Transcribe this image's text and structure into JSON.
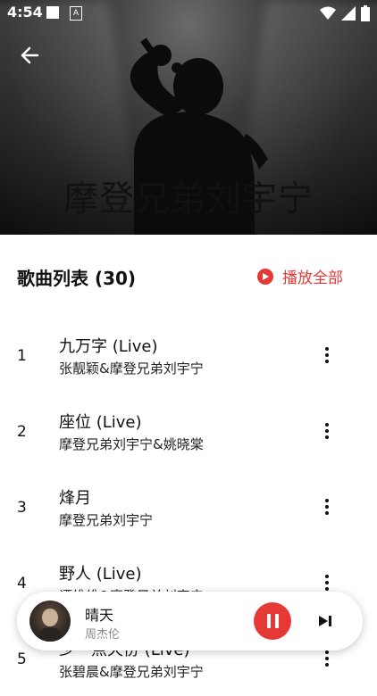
{
  "status_bar": {
    "time": "4:54",
    "notification_icon_letter": "A",
    "icons": [
      "square-icon",
      "a-notification-icon",
      "wifi-icon",
      "signal-icon",
      "battery-icon"
    ]
  },
  "header": {
    "back_icon": "arrow-left-icon",
    "artist_name": "摩登兄弟刘宇宁"
  },
  "list": {
    "title": "歌曲列表 (30)",
    "play_all_label": "播放全部",
    "play_all_icon": "play-circle-icon",
    "accent_color": "#e53935",
    "songs": [
      {
        "index": "1",
        "name": "九万字 (Live)",
        "artist": "张靓颖&摩登兄弟刘宇宁"
      },
      {
        "index": "2",
        "name": "座位 (Live)",
        "artist": "摩登兄弟刘宇宁&姚晓棠"
      },
      {
        "index": "3",
        "name": "烽月",
        "artist": "摩登兄弟刘宇宁"
      },
      {
        "index": "4",
        "name": "野人 (Live)",
        "artist": "谭维维&摩登兄弟刘宇宁"
      },
      {
        "index": "5",
        "name": "少一点天份 (Live)",
        "artist": "张碧晨&摩登兄弟刘宇宁"
      }
    ]
  },
  "mini_player": {
    "title": "晴天",
    "artist": "周杰伦",
    "pause_icon": "pause-icon",
    "next_icon": "skip-next-icon"
  }
}
